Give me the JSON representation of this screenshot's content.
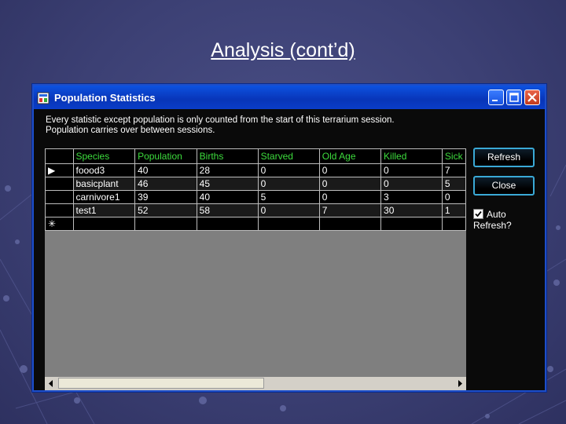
{
  "slide": {
    "title": "Analysis (cont’d)"
  },
  "window": {
    "title": "Population Statistics",
    "info_line1": "Every statistic except population is only counted from the start of this terrarium session.",
    "info_line2": "Population carries over between sessions.",
    "icons": {
      "app": "app-icon",
      "minimize": "minimize-icon",
      "maximize": "maximize-icon",
      "close": "close-icon"
    }
  },
  "grid": {
    "columns": [
      "Species",
      "Population",
      "Births",
      "Starved",
      "Old Age",
      "Killed",
      "Sick"
    ],
    "rows": [
      [
        "foood3",
        "40",
        "28",
        "0",
        "0",
        "0",
        "7"
      ],
      [
        "basicplant",
        "46",
        "45",
        "0",
        "0",
        "0",
        "5"
      ],
      [
        "carnivore1",
        "39",
        "40",
        "5",
        "0",
        "3",
        "0"
      ],
      [
        "test1",
        "52",
        "58",
        "0",
        "7",
        "30",
        "1"
      ]
    ],
    "current_row_marker": "▶",
    "new_row_marker": "✳"
  },
  "buttons": {
    "refresh": "Refresh",
    "close": "Close"
  },
  "auto_refresh": {
    "label": "Auto Refresh?",
    "checked": true
  },
  "colors": {
    "header_text": "#3ddc3d",
    "titlebar": "#0a3dc8",
    "button_border": "#3aa9d6"
  }
}
